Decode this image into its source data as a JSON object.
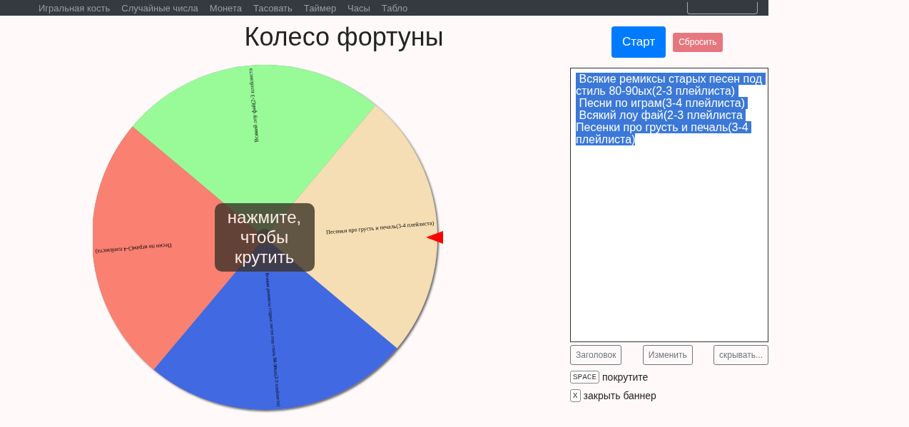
{
  "nav": {
    "links": [
      "Игральная кость",
      "Случайные числа",
      "Монета",
      "Тасовать",
      "Таймер",
      "Часы",
      "Табло"
    ]
  },
  "title": "Колесо фортуны",
  "wheel": {
    "segments": [
      {
        "label": "Всякий лоу фай(2-3 плейлиста",
        "color": "#98fb98"
      },
      {
        "label": "Песенки про грусть и печаль(3-4 плейлиста)",
        "color": "#f5deb3"
      },
      {
        "label": "Всякие ремиксы старых песен под стиль 80-90ых(2-3 плейлиста)",
        "color": "#4169e1"
      },
      {
        "label": "Песни по играм(3-4 плейлиста)",
        "color": "#fa8072"
      }
    ],
    "banner": "нажмите, чтобы крутить"
  },
  "controls": {
    "start": "Старт",
    "reset": "Сбросить"
  },
  "entries": {
    "selected": true,
    "lines": [
      " Всякие ремиксы старых песен под стиль 80-90ых(2-3 плейлиста) ",
      " Песни по играм(3-4 плейлиста) ",
      " Всякий лоу фай(2-3 плейлиста ",
      "Песенки про грусть и печаль(3-4 плейлиста)"
    ]
  },
  "buttons": [
    "Заголовок",
    "Изменить",
    "скрывать..."
  ],
  "shortcuts": [
    {
      "key": "SPACE",
      "action": "покрутите"
    },
    {
      "key": "X",
      "action": "закрыть баннер"
    }
  ]
}
